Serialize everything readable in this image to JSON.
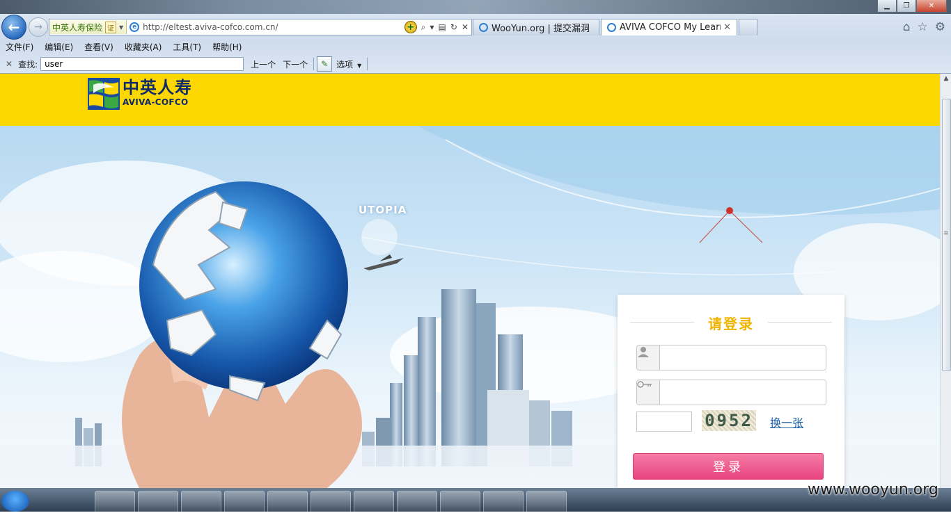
{
  "browser": {
    "identity_label": "中英人寿保险",
    "identity_cert": "证",
    "url": "http://eltest.aviva-cofco.com.cn/",
    "tabs": [
      {
        "label": "WooYun.org | 提交漏洞"
      },
      {
        "label": "AVIVA COFCO My Learni..."
      }
    ]
  },
  "menubar": [
    "文件(F)",
    "编辑(E)",
    "查看(V)",
    "收藏夹(A)",
    "工具(T)",
    "帮助(H)"
  ],
  "findbar": {
    "label": "查找:",
    "value": "user",
    "prev": "上一个",
    "next": "下一个",
    "options": "选项"
  },
  "site": {
    "logo_cn": "中英人寿",
    "logo_en": "AVIVA-COFCO",
    "hero_text": "UTOPIA"
  },
  "login": {
    "title": "请登录",
    "captcha_text": "0952",
    "refresh_label": "换一张",
    "submit_label": "登录"
  },
  "watermark": "www.wooyun.org",
  "colors": {
    "header_yellow": "#fcd800",
    "login_button": "#e8457e",
    "title_gold": "#f0b400"
  }
}
